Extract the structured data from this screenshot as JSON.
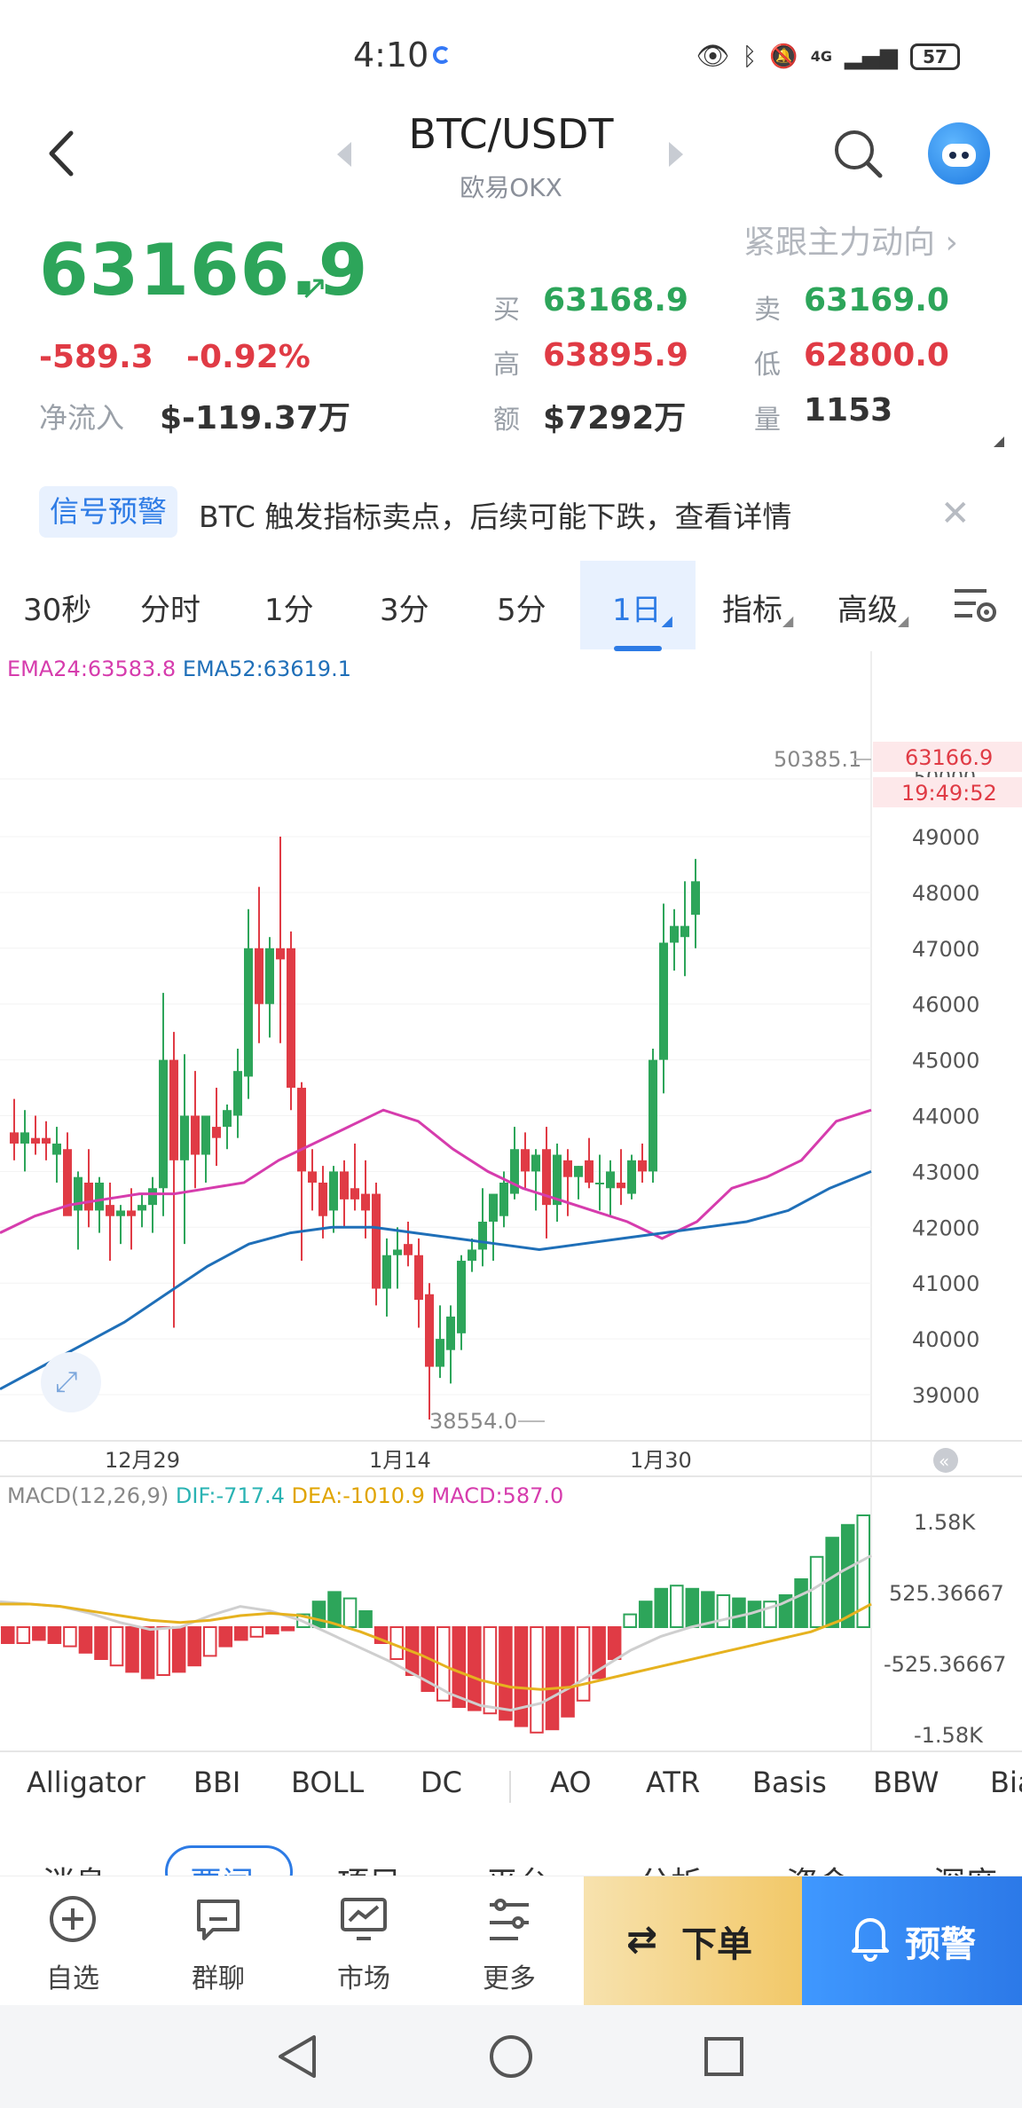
{
  "status_bar": {
    "time": "4:10",
    "battery": "57",
    "network": "4G"
  },
  "header": {
    "title": "BTC/USDT",
    "exchange": "欧易OKX"
  },
  "price": {
    "last": "63166.9",
    "change": "-589.3",
    "change_pct": "-0.92%",
    "netflow_label": "净流入",
    "netflow_value": "$-119.37万",
    "follow_text": "紧跟主力动向 ›"
  },
  "stats": {
    "buy_label": "买",
    "buy_value": "63168.9",
    "sell_label": "卖",
    "sell_value": "63169.0",
    "high_label": "高",
    "high_value": "63895.9",
    "low_label": "低",
    "low_value": "62800.0",
    "amount_label": "额",
    "amount_value": "$7292万",
    "volume_label": "量",
    "volume_value": "1153"
  },
  "signal": {
    "tag": "信号预警",
    "text": "BTC 触发指标卖点，后续可能下跌，查看详情",
    "close": "✕"
  },
  "timeframes": [
    "30秒",
    "分时",
    "1分",
    "3分",
    "5分",
    "1日",
    "指标",
    "高级"
  ],
  "timeframe_active": "1日",
  "legend": {
    "ema24": "EMA24:63583.8",
    "ema52": "EMA52:63619.1",
    "macd": "MACD(12,26,9)",
    "dif": "DIF:-717.4",
    "dea": "DEA:-1010.9",
    "macd_val": "MACD:587.0"
  },
  "colors": {
    "up": "#2da55a",
    "down": "#e03b45",
    "ema24": "#d63cad",
    "ema52": "#1f6fb8",
    "accent": "#2d7be5"
  },
  "chart_data": [
    {
      "type": "candlestick",
      "title": "",
      "y_ticks": [
        39000,
        40000,
        41000,
        42000,
        43000,
        44000,
        45000,
        46000,
        47000,
        48000,
        49000
      ],
      "x_ticks": [
        "12月29",
        "1月14",
        "1月30"
      ],
      "visible_max_label": "50385.1",
      "visible_min_label": "38554.0",
      "last_price_tag": "63166.9",
      "countdown_tag": "19:49:52",
      "top_tick_partial": "50000",
      "candles": [
        {
          "o": 43700,
          "h": 44300,
          "l": 43200,
          "c": 43500
        },
        {
          "o": 43500,
          "h": 44100,
          "l": 43000,
          "c": 43700
        },
        {
          "o": 43600,
          "h": 44000,
          "l": 43300,
          "c": 43500
        },
        {
          "o": 43600,
          "h": 43900,
          "l": 43200,
          "c": 43500
        },
        {
          "o": 43300,
          "h": 43800,
          "l": 42800,
          "c": 43500
        },
        {
          "o": 43400,
          "h": 43700,
          "l": 42500,
          "c": 42200
        },
        {
          "o": 42300,
          "h": 43000,
          "l": 41600,
          "c": 42900
        },
        {
          "o": 42800,
          "h": 43400,
          "l": 42000,
          "c": 42300
        },
        {
          "o": 42300,
          "h": 42900,
          "l": 41900,
          "c": 42800
        },
        {
          "o": 42400,
          "h": 42800,
          "l": 41400,
          "c": 42200
        },
        {
          "o": 42200,
          "h": 42400,
          "l": 41700,
          "c": 42300
        },
        {
          "o": 42300,
          "h": 42700,
          "l": 41600,
          "c": 42200
        },
        {
          "o": 42300,
          "h": 42600,
          "l": 42000,
          "c": 42400
        },
        {
          "o": 42400,
          "h": 42900,
          "l": 41900,
          "c": 42700
        },
        {
          "o": 42700,
          "h": 46200,
          "l": 42200,
          "c": 45000
        },
        {
          "o": 45000,
          "h": 45500,
          "l": 40200,
          "c": 43200
        },
        {
          "o": 43200,
          "h": 45100,
          "l": 41700,
          "c": 44000
        },
        {
          "o": 44000,
          "h": 44800,
          "l": 42700,
          "c": 43300
        },
        {
          "o": 43300,
          "h": 44000,
          "l": 42800,
          "c": 44000
        },
        {
          "o": 43800,
          "h": 44500,
          "l": 43100,
          "c": 43600
        },
        {
          "o": 43800,
          "h": 44200,
          "l": 43400,
          "c": 44100
        },
        {
          "o": 44000,
          "h": 45200,
          "l": 43600,
          "c": 44800
        },
        {
          "o": 44700,
          "h": 47700,
          "l": 44300,
          "c": 47000
        },
        {
          "o": 47000,
          "h": 48100,
          "l": 45300,
          "c": 46000
        },
        {
          "o": 46000,
          "h": 47200,
          "l": 45400,
          "c": 47000
        },
        {
          "o": 47000,
          "h": 49000,
          "l": 45300,
          "c": 46800
        },
        {
          "o": 47000,
          "h": 47300,
          "l": 44100,
          "c": 44500
        },
        {
          "o": 44500,
          "h": 44600,
          "l": 41400,
          "c": 43000
        },
        {
          "o": 43000,
          "h": 43400,
          "l": 42300,
          "c": 42800
        },
        {
          "o": 42800,
          "h": 43100,
          "l": 41800,
          "c": 42200
        },
        {
          "o": 42300,
          "h": 43100,
          "l": 41900,
          "c": 43000
        },
        {
          "o": 43000,
          "h": 43200,
          "l": 42000,
          "c": 42500
        },
        {
          "o": 42700,
          "h": 43500,
          "l": 42300,
          "c": 42500
        },
        {
          "o": 42600,
          "h": 43200,
          "l": 41800,
          "c": 42300
        },
        {
          "o": 42600,
          "h": 42800,
          "l": 40600,
          "c": 40900
        },
        {
          "o": 40900,
          "h": 41800,
          "l": 40400,
          "c": 41500
        },
        {
          "o": 41500,
          "h": 42000,
          "l": 40900,
          "c": 41600
        },
        {
          "o": 41700,
          "h": 42100,
          "l": 41300,
          "c": 41500
        },
        {
          "o": 41500,
          "h": 41800,
          "l": 40200,
          "c": 40700
        },
        {
          "o": 40800,
          "h": 41000,
          "l": 38554,
          "c": 39500
        },
        {
          "o": 39500,
          "h": 40600,
          "l": 39300,
          "c": 40000
        },
        {
          "o": 39800,
          "h": 40600,
          "l": 39200,
          "c": 40400
        },
        {
          "o": 40100,
          "h": 41500,
          "l": 39800,
          "c": 41400
        },
        {
          "o": 41400,
          "h": 41800,
          "l": 41200,
          "c": 41600
        },
        {
          "o": 41600,
          "h": 42700,
          "l": 41300,
          "c": 42100
        },
        {
          "o": 42100,
          "h": 42300,
          "l": 41400,
          "c": 42600
        },
        {
          "o": 42200,
          "h": 43000,
          "l": 42000,
          "c": 42800
        },
        {
          "o": 42600,
          "h": 43800,
          "l": 42500,
          "c": 43400
        },
        {
          "o": 43400,
          "h": 43700,
          "l": 42700,
          "c": 43000
        },
        {
          "o": 43000,
          "h": 43400,
          "l": 42300,
          "c": 43300
        },
        {
          "o": 43400,
          "h": 43800,
          "l": 41800,
          "c": 42400
        },
        {
          "o": 42400,
          "h": 43500,
          "l": 42100,
          "c": 43300
        },
        {
          "o": 43200,
          "h": 43400,
          "l": 42200,
          "c": 42900
        },
        {
          "o": 42900,
          "h": 43100,
          "l": 42500,
          "c": 43100
        },
        {
          "o": 43200,
          "h": 43600,
          "l": 42700,
          "c": 42800
        },
        {
          "o": 42800,
          "h": 43300,
          "l": 42300,
          "c": 42800
        },
        {
          "o": 42700,
          "h": 43200,
          "l": 42200,
          "c": 43000
        },
        {
          "o": 42800,
          "h": 43400,
          "l": 42400,
          "c": 42700
        },
        {
          "o": 42600,
          "h": 43300,
          "l": 42500,
          "c": 43200
        },
        {
          "o": 43200,
          "h": 43500,
          "l": 42800,
          "c": 43000
        },
        {
          "o": 43000,
          "h": 45200,
          "l": 42800,
          "c": 45000
        },
        {
          "o": 45000,
          "h": 47800,
          "l": 44400,
          "c": 47100
        },
        {
          "o": 47100,
          "h": 47700,
          "l": 46600,
          "c": 47400
        },
        {
          "o": 47200,
          "h": 48200,
          "l": 46500,
          "c": 47400
        },
        {
          "o": 47600,
          "h": 48600,
          "l": 47000,
          "c": 48200
        }
      ],
      "ema24": [
        41900,
        42200,
        42400,
        42500,
        42600,
        42600,
        42700,
        42800,
        43200,
        43500,
        43800,
        44100,
        43900,
        43400,
        43000,
        42700,
        42500,
        42300,
        42100,
        41800,
        42100,
        42700,
        42900,
        43200,
        43900,
        44100
      ],
      "ema52": [
        39100,
        39500,
        39900,
        40300,
        40800,
        41300,
        41700,
        41900,
        42000,
        42000,
        41900,
        41800,
        41700,
        41600,
        41700,
        41800,
        41900,
        42000,
        42100,
        42300,
        42700,
        43000
      ]
    },
    {
      "type": "macd",
      "y_ticks": [
        "1.58K",
        "525.36667",
        "-525.36667",
        "-1.58K"
      ],
      "histogram": [
        -0.5,
        -0.5,
        -0.4,
        -0.5,
        -0.6,
        -0.8,
        -1.0,
        -1.2,
        -1.4,
        -1.6,
        -1.5,
        -1.4,
        -1.2,
        -0.9,
        -0.6,
        -0.4,
        -0.3,
        -0.2,
        -0.1,
        0.4,
        0.8,
        1.1,
        0.9,
        0.5,
        -0.5,
        -1.0,
        -1.5,
        -2.0,
        -2.3,
        -2.5,
        -2.6,
        -2.7,
        -2.9,
        -3.1,
        -3.3,
        -3.2,
        -2.8,
        -2.3,
        -1.6,
        -1.0,
        0.4,
        0.8,
        1.2,
        1.3,
        1.2,
        1.1,
        1.0,
        0.9,
        0.8,
        0.8,
        1.0,
        1.5,
        2.2,
        2.8,
        3.2,
        3.5
      ]
    }
  ],
  "indicators": [
    "Alligator",
    "BBI",
    "BOLL",
    "DC",
    "AO",
    "ATR",
    "Basis",
    "BBW",
    "Bia"
  ],
  "subtabs": [
    "消息",
    "要闻",
    "项目",
    "平台",
    "分析",
    "资金",
    "深度"
  ],
  "bottom_nav": {
    "watchlist": "自选",
    "chat": "群聊",
    "market": "市场",
    "more": "更多",
    "order": "下单",
    "alert": "预警"
  }
}
